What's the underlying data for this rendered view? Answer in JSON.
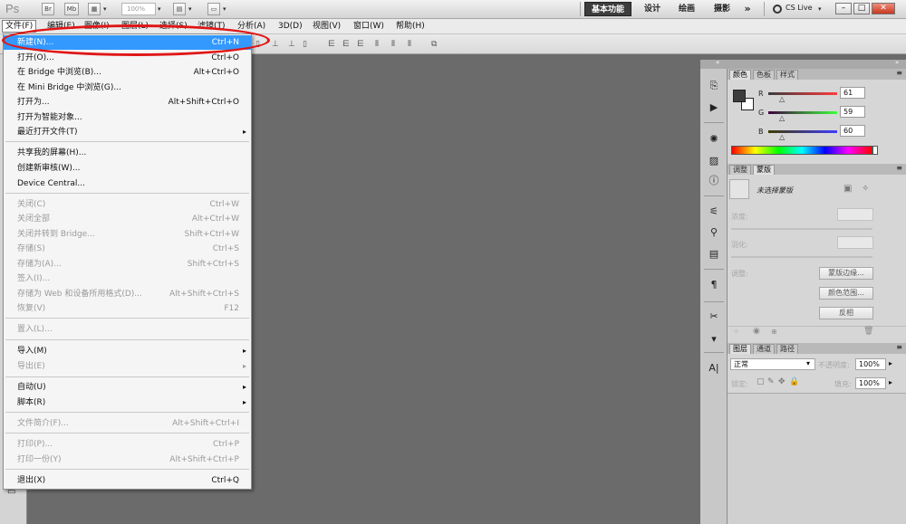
{
  "titlebar": {
    "logo": "Ps",
    "zoom": "100%",
    "workspaces": [
      "基本功能",
      "设计",
      "绘画",
      "摄影"
    ],
    "more": "»",
    "cs_live": "CS Live",
    "min": "–",
    "max": "□",
    "close": "✕"
  },
  "menubar": {
    "items": [
      "文件(F)",
      "编辑(E)",
      "图像(I)",
      "图层(L)",
      "选择(S)",
      "滤镜(T)",
      "分析(A)",
      "3D(D)",
      "视图(V)",
      "窗口(W)",
      "帮助(H)"
    ]
  },
  "file_menu": {
    "items": [
      {
        "label": "新建(N)...",
        "shortcut": "Ctrl+N"
      },
      {
        "label": "打开(O)...",
        "shortcut": "Ctrl+O"
      },
      {
        "label": "在 Bridge 中浏览(B)...",
        "shortcut": "Alt+Ctrl+O"
      },
      {
        "label": "在 Mini Bridge 中浏览(G)...",
        "shortcut": ""
      },
      {
        "label": "打开为...",
        "shortcut": "Alt+Shift+Ctrl+O"
      },
      {
        "label": "打开为智能对象...",
        "shortcut": ""
      },
      {
        "label": "最近打开文件(T)",
        "shortcut": ""
      },
      {
        "label": "共享我的屏幕(H)...",
        "shortcut": ""
      },
      {
        "label": "创建新审核(W)...",
        "shortcut": ""
      },
      {
        "label": "Device Central...",
        "shortcut": ""
      },
      {
        "label": "关闭(C)",
        "shortcut": "Ctrl+W"
      },
      {
        "label": "关闭全部",
        "shortcut": "Alt+Ctrl+W"
      },
      {
        "label": "关闭并转到 Bridge...",
        "shortcut": "Shift+Ctrl+W"
      },
      {
        "label": "存储(S)",
        "shortcut": "Ctrl+S"
      },
      {
        "label": "存储为(A)...",
        "shortcut": "Shift+Ctrl+S"
      },
      {
        "label": "签入(I)...",
        "shortcut": ""
      },
      {
        "label": "存储为 Web 和设备所用格式(D)...",
        "shortcut": "Alt+Shift+Ctrl+S"
      },
      {
        "label": "恢复(V)",
        "shortcut": "F12"
      },
      {
        "label": "置入(L)...",
        "shortcut": ""
      },
      {
        "label": "导入(M)",
        "shortcut": ""
      },
      {
        "label": "导出(E)",
        "shortcut": ""
      },
      {
        "label": "自动(U)",
        "shortcut": ""
      },
      {
        "label": "脚本(R)",
        "shortcut": ""
      },
      {
        "label": "文件简介(F)...",
        "shortcut": "Alt+Shift+Ctrl+I"
      },
      {
        "label": "打印(P)...",
        "shortcut": "Ctrl+P"
      },
      {
        "label": "打印一份(Y)",
        "shortcut": "Alt+Shift+Ctrl+P"
      },
      {
        "label": "退出(X)",
        "shortcut": "Ctrl+Q"
      }
    ],
    "submenu_arrow": "▸"
  },
  "color_panel": {
    "tabs": [
      "颜色",
      "色板",
      "样式"
    ],
    "r_label": "R",
    "g_label": "G",
    "b_label": "B",
    "r": "61",
    "g": "59",
    "b": "60",
    "foreground_color": "#3d3b3c",
    "background_color": "#ffffff"
  },
  "masks_panel": {
    "tabs": [
      "调整",
      "蒙版"
    ],
    "title": "未选择蒙版",
    "density_label": "浓度:",
    "feather_label": "羽化:",
    "refine_label": "调整:",
    "mask_edge": "蒙版边缘...",
    "color_range": "颜色范围...",
    "invert": "反相"
  },
  "layers_panel": {
    "tabs": [
      "图层",
      "通道",
      "路径"
    ],
    "blend_mode": "正常",
    "opacity_label": "不透明度:",
    "opacity": "100%",
    "lock_label": "锁定:",
    "fill_label": "填充:",
    "fill": "100%"
  },
  "colors": {
    "highlight": "#3399ff",
    "annotation": "#e01616",
    "canvas": "#6b6b6b"
  }
}
